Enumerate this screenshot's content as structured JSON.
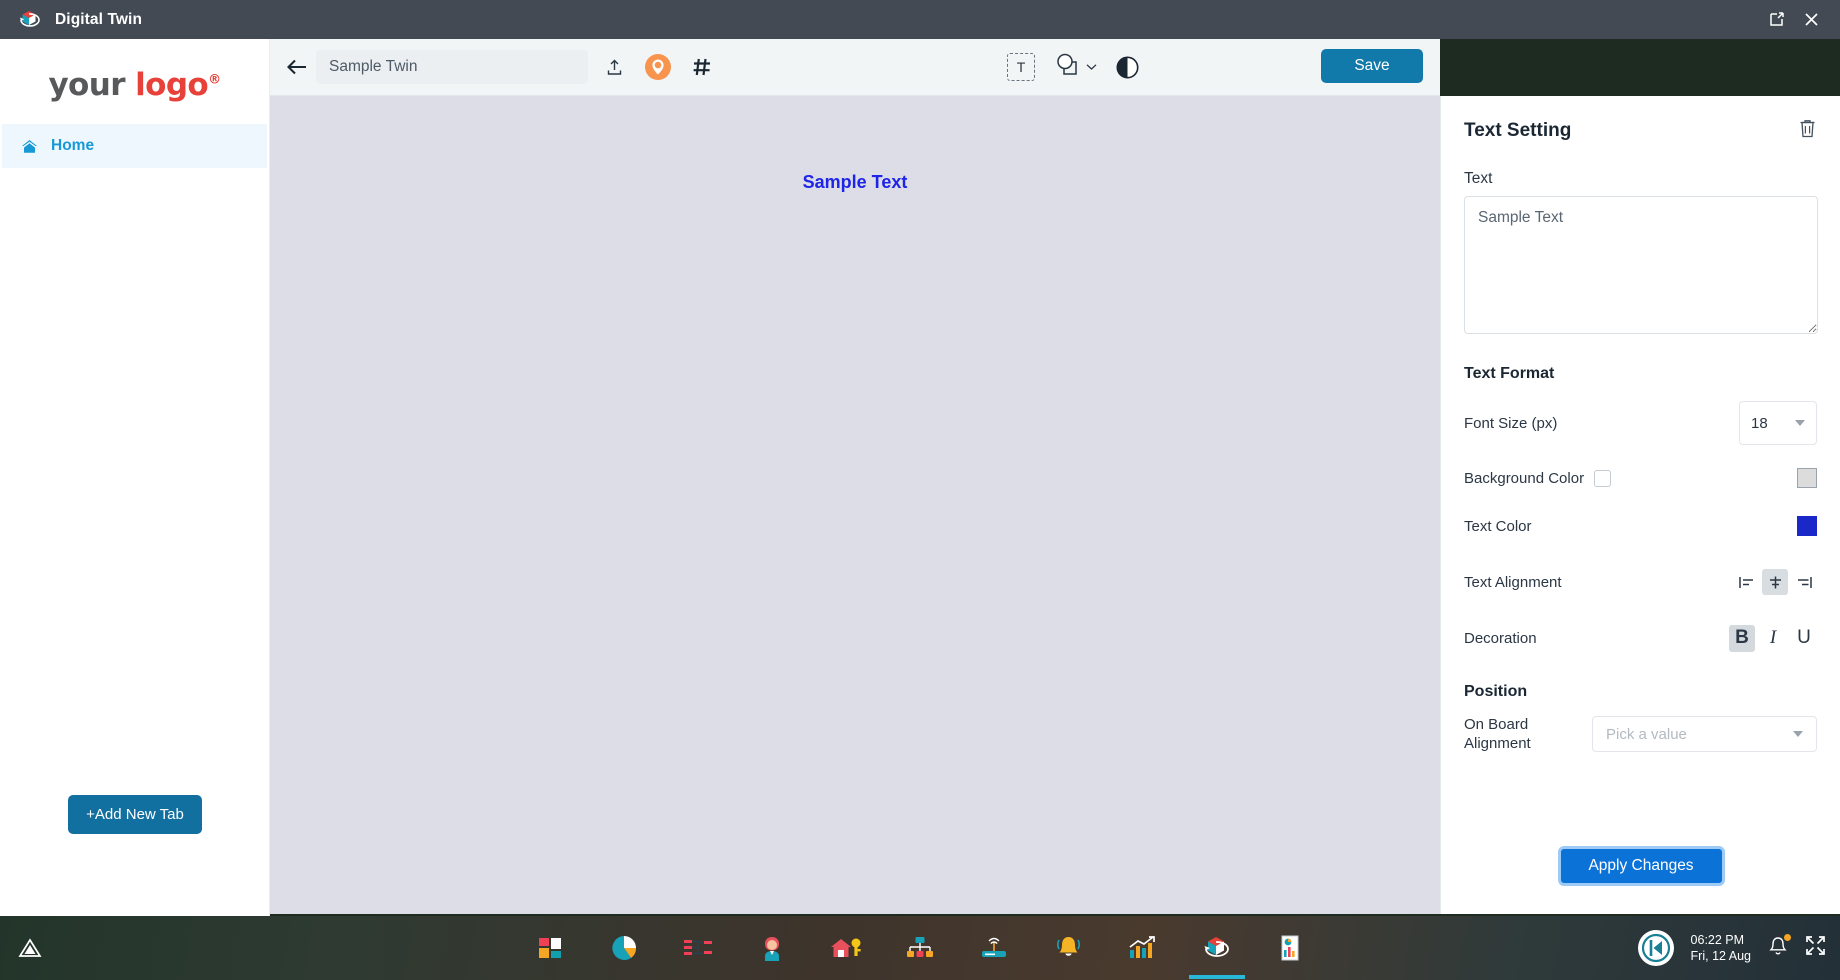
{
  "titlebar": {
    "app_title": "Digital Twin",
    "logo_icon": "digital-twin-cube-icon",
    "restore_icon": "restore-window-icon",
    "close_icon": "close-window-icon"
  },
  "sidebar": {
    "logo": {
      "part1": "your ",
      "part2": "logo",
      "registered": "®"
    },
    "items": [
      {
        "label": "Home",
        "icon": "home-icon",
        "active": true
      }
    ],
    "add_tab_label": "+Add New Tab"
  },
  "toolbar": {
    "back_icon": "back-arrow-icon",
    "twin_name_value": "Sample Twin",
    "twin_name_placeholder": "Twin name",
    "upload_icon": "upload-icon",
    "location_icon": "location-pin-icon",
    "grid_icon": "hash-grid-icon",
    "text_tool_label": "T",
    "text_tool_icon": "text-tool-icon",
    "shape_tool_icon": "shape-tool-icon",
    "shape_caret_icon": "chevron-down-icon",
    "contrast_icon": "contrast-icon",
    "save_label": "Save"
  },
  "canvas": {
    "text_object": "Sample Text",
    "text_color": "#1e25e8",
    "background": "#dcdde6",
    "scroll_left_arrow": "scroll-left-arrow-icon"
  },
  "panel": {
    "title": "Text Setting",
    "delete_icon": "trash-icon",
    "text_label": "Text",
    "text_value": "Sample Text",
    "text_placeholder": "Enter text",
    "format_label": "Text Format",
    "font_size_label": "Font Size (px)",
    "font_size_value": "18",
    "background_color_label": "Background Color",
    "background_color_checked": false,
    "background_color_swatch": "#dcdcdc",
    "text_color_label": "Text Color",
    "text_color_swatch": "#1a27c9",
    "alignment_label": "Text Alignment",
    "alignment_options": [
      {
        "name": "align-left-icon",
        "active": false
      },
      {
        "name": "align-center-icon",
        "active": true
      },
      {
        "name": "align-right-icon",
        "active": false
      }
    ],
    "decoration_label": "Decoration",
    "decoration_options": [
      {
        "label": "B",
        "name": "bold-icon",
        "active": true
      },
      {
        "label": "I",
        "name": "italic-icon",
        "active": false
      },
      {
        "label": "U",
        "name": "underline-icon",
        "active": false
      }
    ],
    "position_label": "Position",
    "board_alignment_label_line1": "On Board",
    "board_alignment_label_line2": "Alignment",
    "board_alignment_placeholder": "Pick a value",
    "apply_label": "Apply Changes"
  },
  "taskbar": {
    "warning_icon": "warning-triangle-icon",
    "apps": [
      {
        "name": "dashboard-tiles-icon",
        "active": false
      },
      {
        "name": "pie-chart-icon",
        "active": false
      },
      {
        "name": "process-flow-icon",
        "active": false
      },
      {
        "name": "operator-avatar-icon",
        "active": false
      },
      {
        "name": "home-key-icon",
        "active": false
      },
      {
        "name": "org-chart-icon",
        "active": false
      },
      {
        "name": "router-antenna-icon",
        "active": false
      },
      {
        "name": "alarm-bell-icon",
        "active": false
      },
      {
        "name": "analytics-growth-icon",
        "active": false
      },
      {
        "name": "digital-twin-cube-icon",
        "active": true
      },
      {
        "name": "report-document-icon",
        "active": false
      }
    ],
    "tray_logo_icon": "brand-logo-icon",
    "time": "06:22 PM",
    "date": "Fri, 12 Aug",
    "notification_icon": "bell-icon",
    "fullscreen_icon": "fullscreen-icon"
  }
}
